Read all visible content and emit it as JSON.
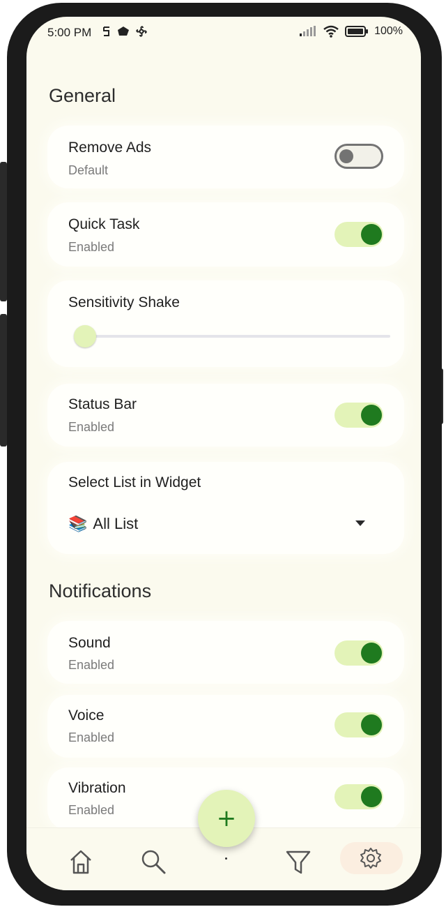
{
  "status_bar": {
    "time": "5:00 PM",
    "battery": "100%"
  },
  "sections": {
    "general_title": "General",
    "notifications_title": "Notifications"
  },
  "settings": {
    "remove_ads": {
      "title": "Remove Ads",
      "status": "Default",
      "enabled": false
    },
    "quick_task": {
      "title": "Quick Task",
      "status": "Enabled",
      "enabled": true
    },
    "sensitivity_shake": {
      "title": "Sensitivity Shake",
      "value": 0
    },
    "status_bar": {
      "title": "Status Bar",
      "status": "Enabled",
      "enabled": true
    },
    "select_list": {
      "title": "Select List in Widget",
      "emoji": "📚",
      "value": "All List"
    },
    "sound": {
      "title": "Sound",
      "status": "Enabled",
      "enabled": true
    },
    "voice": {
      "title": "Voice",
      "status": "Enabled",
      "enabled": true
    },
    "vibration": {
      "title": "Vibration",
      "status": "Enabled",
      "enabled": true
    }
  },
  "fab": {
    "label": "+"
  },
  "bottom_nav": {
    "items": [
      "home-icon",
      "search-icon",
      "filter-icon",
      "settings-icon"
    ],
    "active": "settings-icon"
  },
  "colors": {
    "background": "#fbfaee",
    "accent": "#1f7a1f",
    "accent_light": "#e3f3b8",
    "nav_active": "#fbeee0"
  }
}
